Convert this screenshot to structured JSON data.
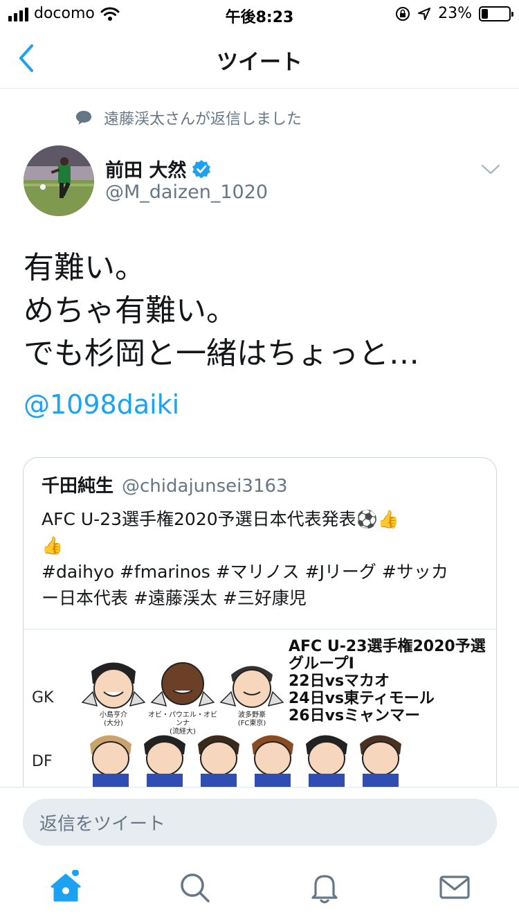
{
  "status_bar": {
    "carrier": "docomo",
    "time": "午後8:23",
    "battery_percent": "23%",
    "battery_level": 0.23
  },
  "nav": {
    "title": "ツイート",
    "back_icon": "chevron-left-icon"
  },
  "reply_context": {
    "text": "遠藤渓太さんが返信しました",
    "icon": "speech-bubble-icon"
  },
  "tweet": {
    "author_name": "前田 大然",
    "author_verified": true,
    "author_handle": "@M_daizen_1020",
    "text_lines": [
      "有難い。",
      "めちゃ有難い。",
      "でも杉岡と一緒はちょっと…"
    ],
    "mention": "@1098daiki"
  },
  "quoted_tweet": {
    "author_name": "千田純生",
    "author_handle": "@chidajunsei3163",
    "text_lines": [
      "AFC U-23選手権2020予選日本代表発表⚽️👍",
      "👍",
      "#daihyo #fmarinos #マリノス #Jリーグ #サッカ",
      "ー日本代表 #遠藤渓太 #三好康児"
    ],
    "image": {
      "row_labels": [
        "GK",
        "DF"
      ],
      "info_lines": [
        "AFC U-23選手権2020予選",
        "グループI",
        "22日vsマカオ",
        "24日vs東ティモール",
        "26日vsミャンマー"
      ],
      "gk_captions": [
        [
          "小島亨介",
          "(大分)"
        ],
        [
          "オビ・パウエル・オビンナ",
          "(流経大)"
        ],
        [
          "波多野豪",
          "(FC東京)"
        ]
      ]
    }
  },
  "reply_box": {
    "placeholder": "返信をツイート"
  },
  "tab_bar": {
    "items": [
      "home-icon",
      "search-icon",
      "notifications-icon",
      "messages-icon"
    ]
  },
  "colors": {
    "accent": "#1da1f2",
    "secondary_text": "#657786",
    "divider": "#e1e8ed"
  }
}
